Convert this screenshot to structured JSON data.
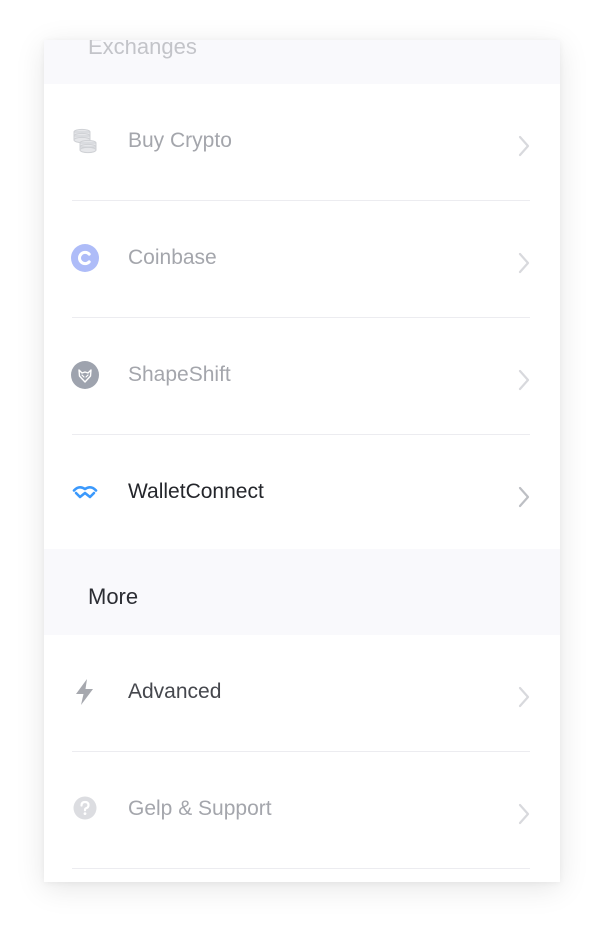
{
  "sections": {
    "exchanges": {
      "title": "Exchanges",
      "items": [
        {
          "label": "Buy Crypto",
          "icon": "coins-icon"
        },
        {
          "label": "Coinbase",
          "icon": "coinbase-icon"
        },
        {
          "label": "ShapeShift",
          "icon": "shapeshift-icon"
        },
        {
          "label": "WalletConnect",
          "icon": "walletconnect-icon"
        }
      ]
    },
    "more": {
      "title": "More",
      "items": [
        {
          "label": "Advanced",
          "icon": "lightning-icon"
        },
        {
          "label": "Gelp & Support",
          "icon": "help-icon"
        }
      ]
    }
  },
  "colors": {
    "header_bg": "#f9f9fc",
    "muted_text": "#a4a6ac",
    "active_text": "#24262b",
    "coinbase": "#aebcf8",
    "walletconnect": "#3b99fc",
    "divider": "#ececf0"
  }
}
